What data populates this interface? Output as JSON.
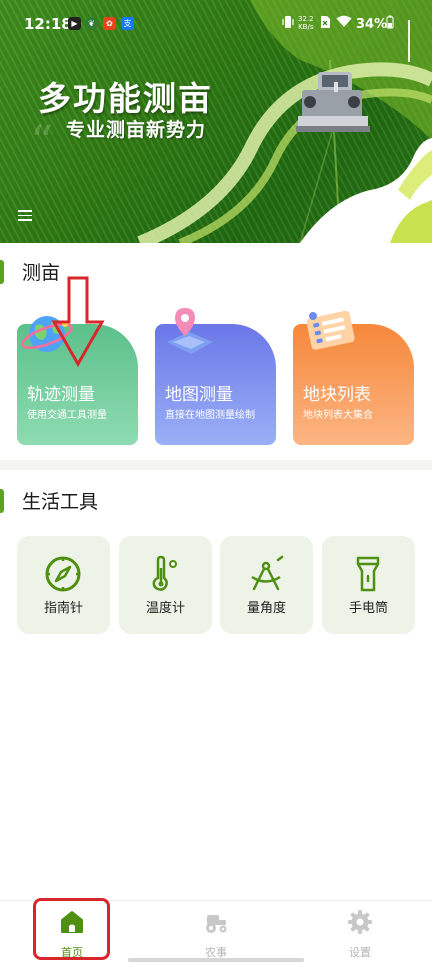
{
  "status_bar": {
    "time": "12:18",
    "network_speed_value": "32.2",
    "network_speed_unit": "KB/s",
    "battery": "34%"
  },
  "hero": {
    "title": "多功能测亩",
    "subtitle": "专业测亩新势力"
  },
  "measure_section": {
    "title": "测亩",
    "cards": [
      {
        "title": "轨迹测量",
        "desc": "使用交通工具测量",
        "color": "#5cc08a"
      },
      {
        "title": "地图测量",
        "desc": "直接在地图测量绘制",
        "color": "#6b77e8"
      },
      {
        "title": "地块列表",
        "desc": "地块列表大集合",
        "color": "#f5883a"
      }
    ]
  },
  "tools_section": {
    "title": "生活工具",
    "tools": [
      {
        "label": "指南针",
        "icon": "compass-icon"
      },
      {
        "label": "温度计",
        "icon": "thermometer-icon"
      },
      {
        "label": "量角度",
        "icon": "protractor-icon"
      },
      {
        "label": "手电筒",
        "icon": "flashlight-icon"
      }
    ]
  },
  "bottom_nav": {
    "items": [
      {
        "label": "首页",
        "icon": "home-icon",
        "active": true
      },
      {
        "label": "农事",
        "icon": "tractor-icon",
        "active": false
      },
      {
        "label": "设置",
        "icon": "gear-icon",
        "active": false
      }
    ]
  },
  "colors": {
    "accent": "#5ca21c",
    "annotation_red": "#d9262b",
    "inactive_nav": "#c8c8c8"
  }
}
